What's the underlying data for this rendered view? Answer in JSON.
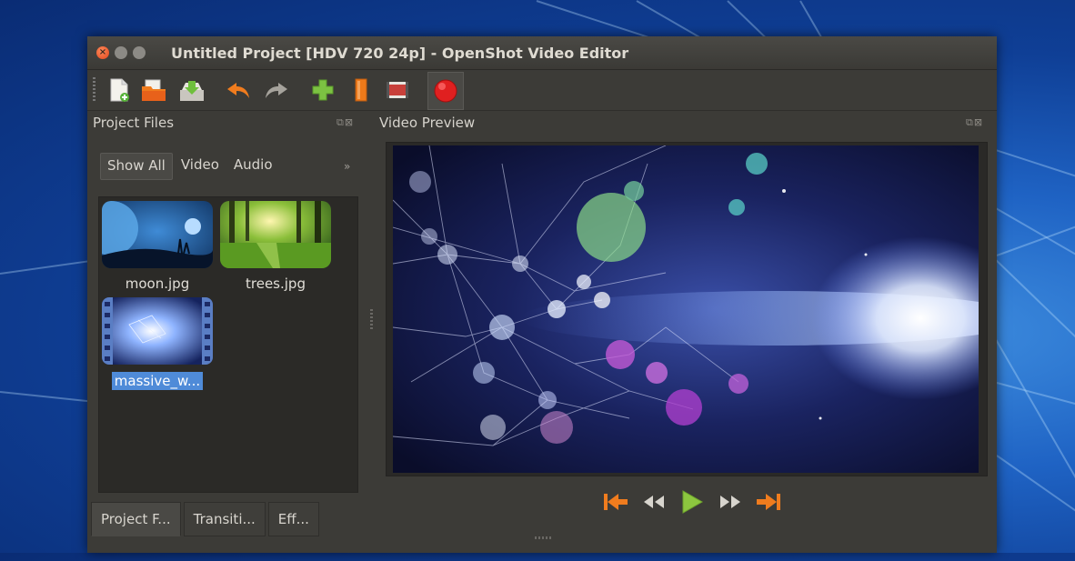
{
  "window": {
    "title": "Untitled Project [HDV 720 24p] - OpenShot Video Editor"
  },
  "toolbar": {
    "buttons": [
      {
        "name": "new-project",
        "icon": "new-file-icon"
      },
      {
        "name": "open-project",
        "icon": "open-folder-icon"
      },
      {
        "name": "save-project",
        "icon": "save-download-icon"
      },
      {
        "name": "undo",
        "icon": "undo-arrow-icon"
      },
      {
        "name": "redo",
        "icon": "redo-arrow-icon"
      },
      {
        "name": "import-files",
        "icon": "green-plus-icon"
      },
      {
        "name": "choose-profile",
        "icon": "orange-bar-icon"
      },
      {
        "name": "fullscreen",
        "icon": "film-icon"
      },
      {
        "name": "export-video",
        "icon": "red-record-icon"
      }
    ]
  },
  "project_files": {
    "heading": "Project Files",
    "filters": [
      "Show All",
      "Video",
      "Audio"
    ],
    "active_filter": "Show All",
    "more": "»",
    "files": [
      {
        "name": "moon.jpg",
        "selected": false
      },
      {
        "name": "trees.jpg",
        "selected": false
      },
      {
        "name": "massive_w...",
        "selected": true
      }
    ]
  },
  "video_preview": {
    "heading": "Video Preview"
  },
  "playback": {
    "buttons": [
      "jump-start",
      "rewind",
      "play",
      "fast-forward",
      "jump-end"
    ]
  },
  "bottom_tabs": [
    "Project F...",
    "Transiti...",
    "Eff..."
  ],
  "colors": {
    "window_bg": "#3c3b37",
    "accent_orange": "#f07c1e",
    "play_green": "#8cc63f",
    "selection_blue": "#4f8bd8",
    "close_button": "#e0451c",
    "record_red": "#e02020"
  }
}
